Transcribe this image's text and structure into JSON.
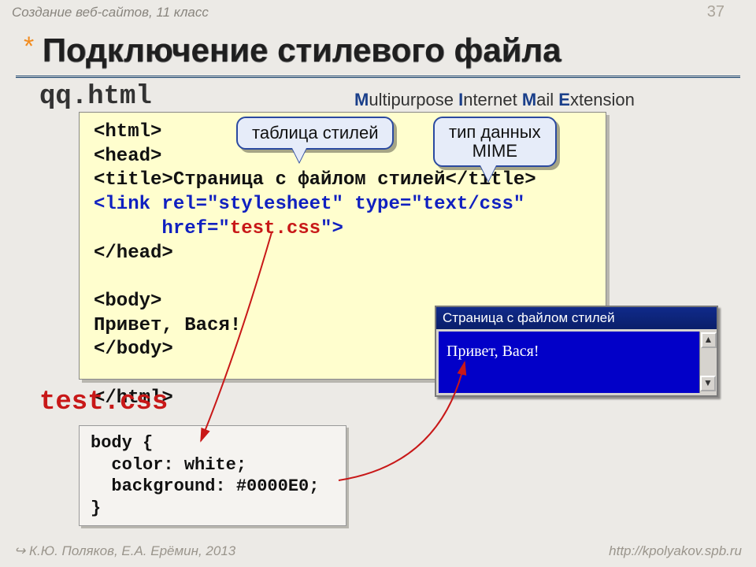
{
  "header": {
    "course": "Создание веб-сайтов, 11 класс",
    "page_number": "37"
  },
  "title": {
    "asterisk": "*",
    "text": "Подключение стилевого файла"
  },
  "filenames": {
    "html": "qq.html",
    "css": "test.css"
  },
  "mime": {
    "M": "M",
    "t1": "ultipurpose ",
    "I": "I",
    "t2": "nternet ",
    "M2": "M",
    "t3": "ail ",
    "E": "E",
    "t4": "xtension"
  },
  "callouts": {
    "stylesheet": "таблица стилей",
    "mime_type": "тип данных\nMIME"
  },
  "code_html": {
    "l1": "<html>",
    "l2": "<head>",
    "l3a": "<title>",
    "l3b": "Страница с файлом стилей",
    "l3c": "</title>",
    "l4": "<link rel=\"stylesheet\" type=\"text/css\"",
    "l5a": "      href=\"",
    "l5b": "test.css",
    "l5c": "\">",
    "l6": "</head>",
    "l7": "<body>",
    "l8": "Привет, Вася!",
    "l9": "</body>",
    "l10": "</html>"
  },
  "code_css": {
    "l1": "body {",
    "l2": "  color: white;",
    "l3": "  background: #0000E0;",
    "l4": "}"
  },
  "browser": {
    "title": "Страница с файлом стилей",
    "body": "Привет, Вася!",
    "up": "▲",
    "dn": "▼"
  },
  "footer": {
    "authors": "К.Ю. Поляков, Е.А. Ерёмин, 2013",
    "url": "http://kpolyakov.spb.ru",
    "arrow": "↪ "
  }
}
